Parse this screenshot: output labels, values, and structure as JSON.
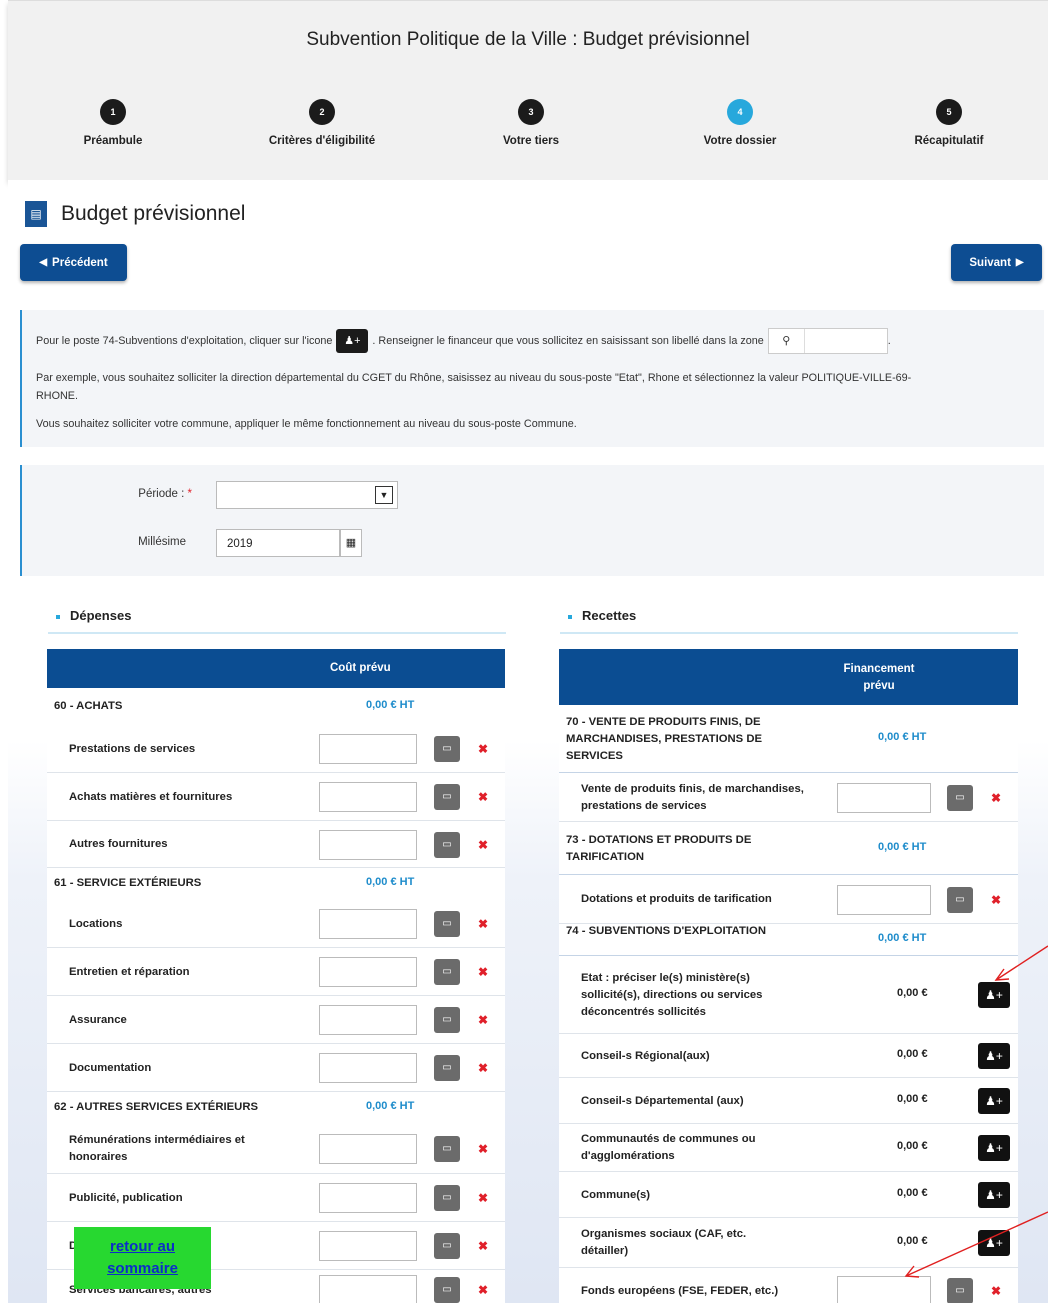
{
  "header": {
    "title": "Subvention Politique de la Ville : Budget prévisionnel",
    "steps": [
      {
        "num": "1",
        "label": "Préambule"
      },
      {
        "num": "2",
        "label": "Critères d'éligibilité"
      },
      {
        "num": "3",
        "label": "Votre tiers"
      },
      {
        "num": "4",
        "label": "Votre dossier",
        "active": true
      },
      {
        "num": "5",
        "label": "Récapitulatif"
      }
    ]
  },
  "page": {
    "title": "Budget prévisionnel",
    "prev_label": "Précédent",
    "next_label": "Suivant"
  },
  "info": {
    "line1_a": "Pour le poste 74-Subventions d'exploitation, cliquer sur l'icone",
    "line1_b": ". Renseigner le financeur que vous sollicitez en saisissant son libellé dans la zone",
    "line1_c": ".",
    "line2": "Par exemple, vous souhaitez solliciter la direction départemental du CGET du Rhône, saisissez au niveau du sous-poste \"Etat\", Rhone et sélectionnez la valeur POLITIQUE-VILLE-69-",
    "line2b": "RHONE.",
    "line3": "Vous souhaitez solliciter votre commune, appliquer le même fonctionnement au niveau du sous-poste Commune."
  },
  "form": {
    "periode_label": "Période :",
    "periode_required": "*",
    "periode_value": "",
    "millesime_label": "Millésime",
    "millesime_value": "2019"
  },
  "depenses": {
    "section_title": "Dépenses",
    "header": "Coût prévu",
    "rows": [
      {
        "type": "cat",
        "label": "60 - ACHATS",
        "amount": "0,00 € HT"
      },
      {
        "type": "item",
        "label": "Prestations de services"
      },
      {
        "type": "item",
        "label": "Achats matières et fournitures"
      },
      {
        "type": "item",
        "label": "Autres fournitures"
      },
      {
        "type": "cat",
        "label": "61 - SERVICE EXTÉRIEURS",
        "amount": "0,00 € HT"
      },
      {
        "type": "item",
        "label": "Locations"
      },
      {
        "type": "item",
        "label": "Entretien et réparation"
      },
      {
        "type": "item",
        "label": "Assurance"
      },
      {
        "type": "item",
        "label": "Documentation"
      },
      {
        "type": "cat",
        "label": "62 - AUTRES SERVICES EXTÉRIEURS",
        "amount": "0,00 € HT"
      },
      {
        "type": "item",
        "label": "Rémunérations intermédiaires et honoraires"
      },
      {
        "type": "item",
        "label": "Publicité, publication"
      },
      {
        "type": "item",
        "label": "D"
      },
      {
        "type": "item",
        "label": "Services bancaires, autres"
      }
    ]
  },
  "recettes": {
    "section_title": "Recettes",
    "header": "Financement prévu",
    "rows": [
      {
        "type": "cat",
        "label": "70 - VENTE DE PRODUITS FINIS, DE MARCHANDISES, PRESTATIONS DE SERVICES",
        "amount": "0,00 € HT"
      },
      {
        "type": "item",
        "label": "Vente de produits finis, de marchandises, prestations de services"
      },
      {
        "type": "cat",
        "label": "73 - DOTATIONS ET PRODUITS DE TARIFICATION",
        "amount": "0,00 € HT"
      },
      {
        "type": "item",
        "label": "Dotations et produits de tarification"
      },
      {
        "type": "cat",
        "label": "74 - SUBVENTIONS D'EXPLOITATION",
        "amount": "0,00 € HT"
      },
      {
        "type": "sub",
        "label": "Etat : préciser le(s) ministère(s) sollicité(s), directions ou services déconcentrés sollicités",
        "amount": "0,00 €"
      },
      {
        "type": "sub",
        "label": "Conseil-s Régional(aux)",
        "amount": "0,00 €"
      },
      {
        "type": "sub",
        "label": "Conseil-s Départemental (aux)",
        "amount": "0,00 €"
      },
      {
        "type": "sub",
        "label": "Communautés de communes ou d'agglomérations",
        "amount": "0,00 €"
      },
      {
        "type": "sub",
        "label": "Commune(s)",
        "amount": "0,00 €"
      },
      {
        "type": "sub",
        "label": "Organismes sociaux (CAF, etc. détailler)",
        "amount": "0,00 €"
      },
      {
        "type": "item",
        "label": "Fonds européens (FSE, FEDER, etc.)"
      }
    ]
  },
  "return_link": {
    "line1": "retour au",
    "line2": "sommaire"
  },
  "icons": {
    "comment": "comment-icon",
    "delete": "trash-icon",
    "add_funder": "add-user-icon",
    "search": "search-icon",
    "calendar": "calendar-icon"
  },
  "colors": {
    "accent": "#27a8dc",
    "primary": "#0b4d92",
    "category": "#1e8ccb",
    "delete": "#e0202a",
    "return_bg": "#27d830"
  }
}
